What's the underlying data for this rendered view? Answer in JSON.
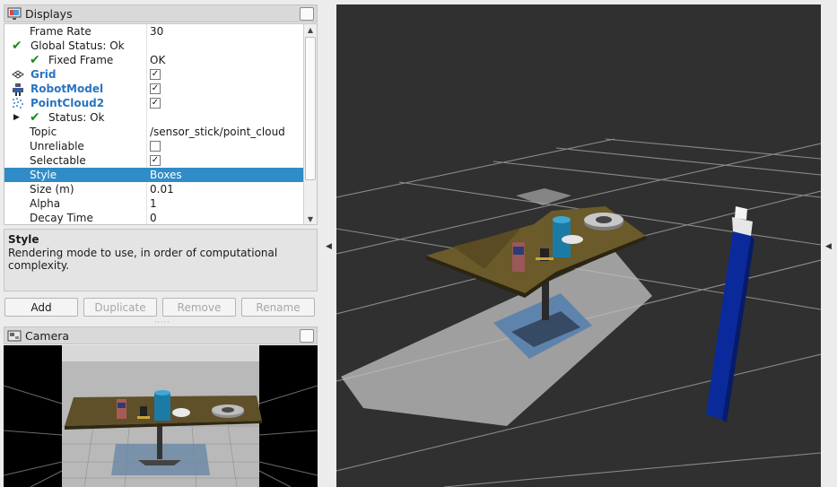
{
  "displays_panel": {
    "title": "Displays",
    "rows": [
      {
        "name": "Frame Rate",
        "value": "30"
      },
      {
        "name": "Global Status: Ok"
      },
      {
        "name": "Fixed Frame",
        "value": "OK"
      },
      {
        "name": "Grid",
        "checked": true
      },
      {
        "name": "RobotModel",
        "checked": true
      },
      {
        "name": "PointCloud2",
        "checked": true
      },
      {
        "name": "Status: Ok"
      },
      {
        "name": "Topic",
        "value": "/sensor_stick/point_cloud"
      },
      {
        "name": "Unreliable",
        "checked": false
      },
      {
        "name": "Selectable",
        "checked": true
      },
      {
        "name": "Style",
        "value": "Boxes",
        "selected": true
      },
      {
        "name": "Size (m)",
        "value": "0.01"
      },
      {
        "name": "Alpha",
        "value": "1"
      },
      {
        "name": "Decay Time",
        "value": "0"
      }
    ]
  },
  "description": {
    "title": "Style",
    "text": "Rendering mode to use, in order of computational complexity."
  },
  "buttons": {
    "add": "Add",
    "duplicate": "Duplicate",
    "remove": "Remove",
    "rename": "Rename"
  },
  "camera_panel": {
    "title": "Camera"
  },
  "colors": {
    "selection": "#308cc6",
    "viewport_bg": "#303030",
    "grid_line": "#8a8a8a",
    "table_top": "#6b5a2a",
    "sensor_stick": "#0a2a9c",
    "check_green": "#1d8a1d",
    "link_blue": "#2a74c2"
  },
  "icons": {
    "displays": "monitor-icon",
    "camera": "camera-icon",
    "grid": "grid-icon",
    "robot_model": "robot-icon",
    "point_cloud": "point-cloud-icon",
    "status_ok": "checkmark-icon"
  }
}
